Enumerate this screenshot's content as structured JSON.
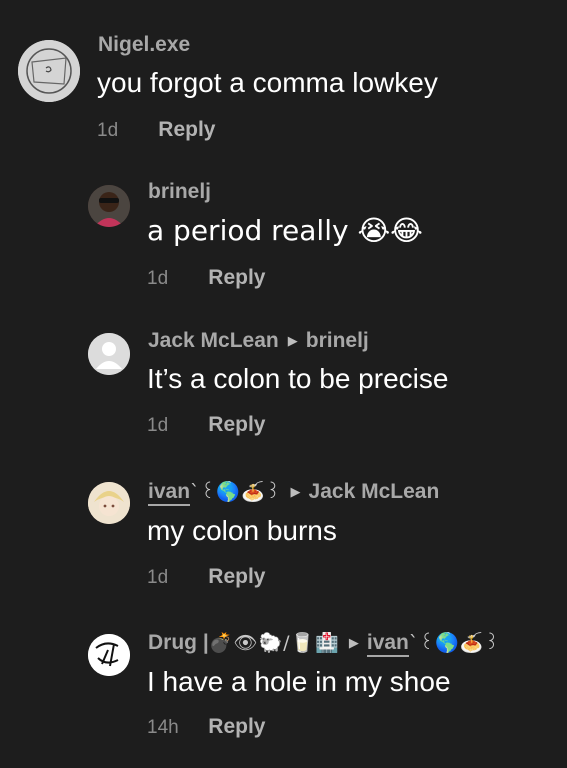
{
  "comments": [
    {
      "username": "Nigel.exe",
      "text": "you forgot a comma lowkey",
      "time": "1d",
      "reply": "Reply"
    },
    {
      "username": "brinelj",
      "text": "a period really 😭😂",
      "time": "1d",
      "reply": "Reply"
    },
    {
      "username": "Jack McLean",
      "reply_to": "brinelj",
      "text": "It’s a colon to be precise",
      "time": "1d",
      "reply": "Reply"
    },
    {
      "username": "ivan",
      "username_deco": "ˋ꒰🌎🍝꒱",
      "reply_to": "Jack McLean",
      "text": "my colon burns",
      "time": "1d",
      "reply": "Reply"
    },
    {
      "username": "Drug |",
      "username_deco": "💣👁🐑/🥛🏥",
      "reply_to": "ivan",
      "reply_to_deco": "ˋ꒰🌎🍝꒱",
      "text": "I have a hole in my shoe",
      "time": "14h",
      "reply": "Reply"
    }
  ],
  "colors": {
    "background": "#1d1d1d",
    "username": "#a8a8a8",
    "text": "#ffffff",
    "time": "#8a8a8a",
    "reply": "#b3b3b3"
  }
}
